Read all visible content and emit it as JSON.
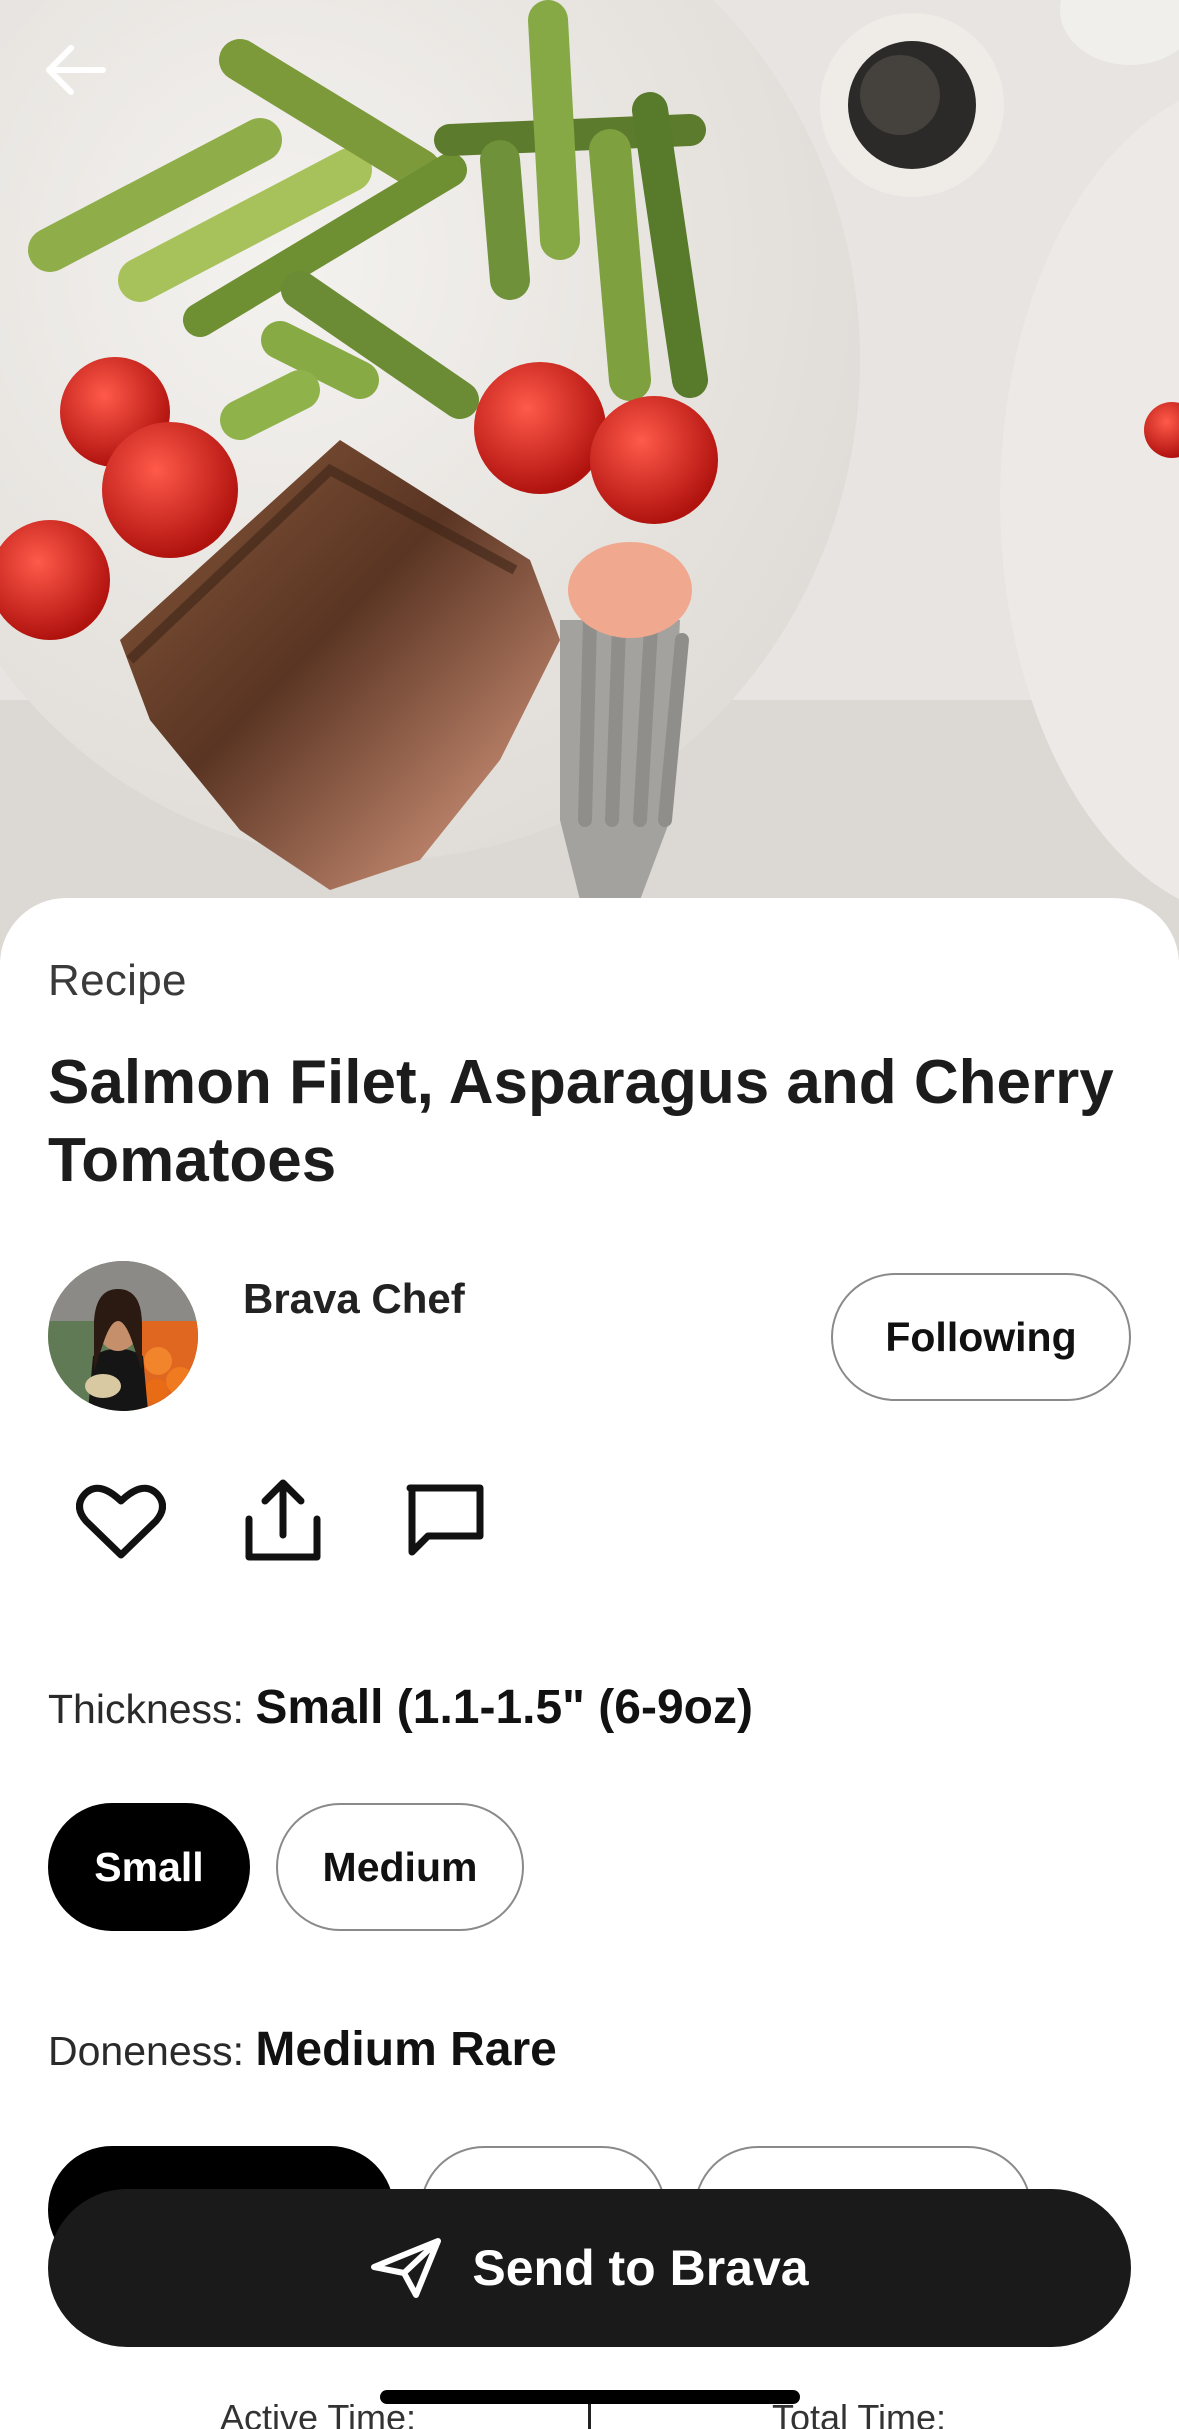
{
  "header": {
    "back_icon": "arrow-left-icon"
  },
  "hero_image": {
    "description_icon": "recipe-photo"
  },
  "recipe": {
    "kind": "Recipe",
    "title": "Salmon Filet, Asparagus and Cherry Tomatoes"
  },
  "author": {
    "name": "Brava Chef",
    "follow_label": "Following"
  },
  "actions": [
    {
      "icon": "heart-icon"
    },
    {
      "icon": "share-icon"
    },
    {
      "icon": "comment-icon"
    }
  ],
  "thickness": {
    "label": "Thickness:",
    "value": "Small (1.1-1.5\" (6-9oz)",
    "options": [
      {
        "label": "Small",
        "selected": true
      },
      {
        "label": "Medium",
        "selected": false
      }
    ]
  },
  "doneness": {
    "label": "Doneness:",
    "value": "Medium Rare",
    "options": [
      {
        "label": "",
        "selected": true
      },
      {
        "label": "",
        "selected": false
      },
      {
        "label": "",
        "selected": false
      }
    ]
  },
  "send": {
    "label": "Send to Brava",
    "icon": "paper-plane-icon"
  },
  "times": {
    "active_label": "Active Time:",
    "total_label": "Total Time:"
  },
  "colors": {
    "primary": "#1a1a1a",
    "pill_border": "#8a8a8a",
    "background": "#ffffff"
  }
}
